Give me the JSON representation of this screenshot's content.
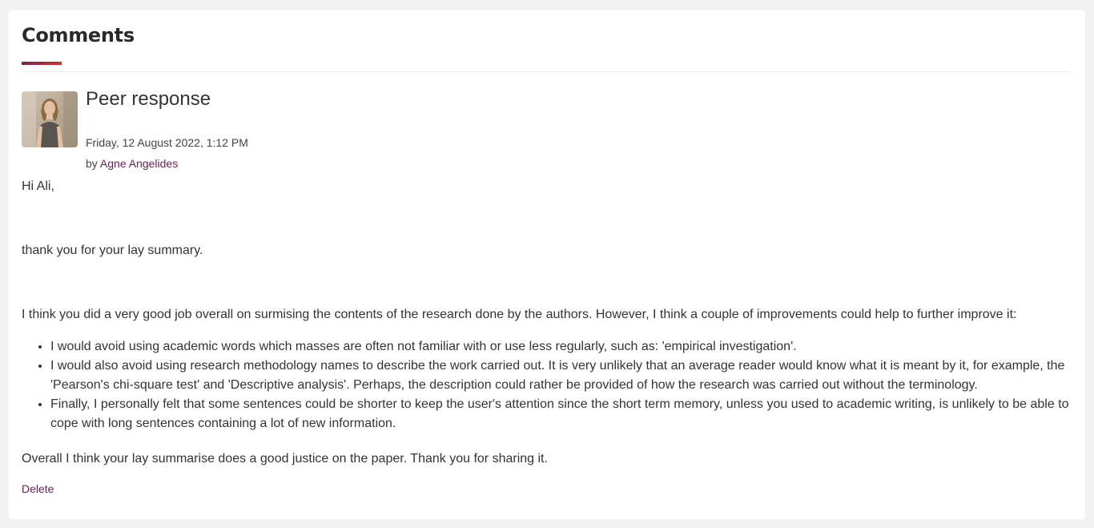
{
  "section": {
    "title": "Comments"
  },
  "comment": {
    "subject": "Peer response",
    "date": "Friday, 12 August 2022, 1:12 PM",
    "by_prefix": "by ",
    "author": "Agne Angelides",
    "avatar_icon": "user-photo-avatar",
    "body": {
      "greeting": "Hi Ali,",
      "thanks": "thank you for your lay summary.",
      "intro": "I think you did a very good job overall on surmising the contents of the research done by the authors. However, I think a couple of improvements could help to further improve it:",
      "bullets": [
        "I would avoid using academic words which masses are often not familiar with or use less regularly, such as: 'empirical investigation'.",
        "I would also avoid using research methodology names to describe the work carried out. It is very unlikely that an average reader would know what it is meant by it, for example, the 'Pearson's chi-square test' and 'Descriptive analysis'. Perhaps, the description could rather be provided of how the research was carried out without the terminology.",
        "Finally, I personally felt that some sentences could be shorter to keep the user's attention since the short term memory, unless you used to academic writing, is unlikely to be able to cope with long sentences containing a lot of new information."
      ],
      "closing": "Overall I think your lay summarise does a good justice on the paper. Thank you for sharing it."
    },
    "actions": {
      "delete_label": "Delete"
    }
  },
  "colors": {
    "accent_link": "#6b1d57",
    "underline_start": "#7a2150",
    "underline_end": "#d0322f",
    "page_background": "#f2f2f2"
  }
}
